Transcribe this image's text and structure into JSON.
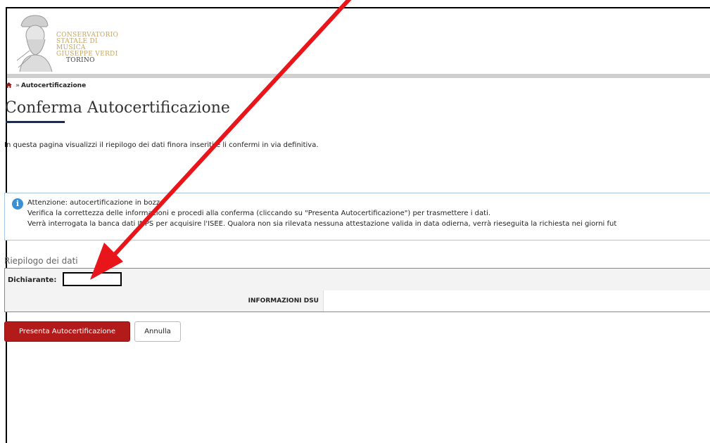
{
  "header": {
    "logo_lines": [
      "CONSERVATORIO",
      "STATALE DI MUSICA",
      "GIUSEPPE VERDI",
      "TORINO"
    ]
  },
  "breadcrumb": {
    "home_icon": "home-icon",
    "separator": "»",
    "current": "Autocertificazione"
  },
  "page_title": "Conferma Autocertificazione",
  "intro_text": "In questa pagina visualizzi il riepilogo dei dati finora inseriti e li confermi in via definitiva.",
  "alert": {
    "icon": "info-icon",
    "icon_glyph": "i",
    "title": "Attenzione: autocertificazione in bozza",
    "line1": "Verifica la correttezza delle informazioni e procedi alla conferma (cliccando su \"Presenta Autocertificazione\") per trasmettere i dati.",
    "line2": "Verrà interrogata la banca dati INPS per acquisire l'ISEE. Qualora non sia rilevata nessuna attestazione valida in data odierna, verrà rieseguita la richiesta nei giorni fut"
  },
  "summary": {
    "section_title": "Riepilogo dei dati",
    "declarant_label": "Dichiarante:",
    "declarant_value": "",
    "dsu_header": "INFORMAZIONI DSU"
  },
  "actions": {
    "submit_label": "Presenta Autocertificazione",
    "cancel_label": "Annulla"
  },
  "colors": {
    "primary_button": "#b31b1b",
    "arrow": "#e8151b",
    "title_underline": "#1e2a4a",
    "info_icon": "#3a8fd6",
    "logo_gold": "#c9a55b"
  }
}
